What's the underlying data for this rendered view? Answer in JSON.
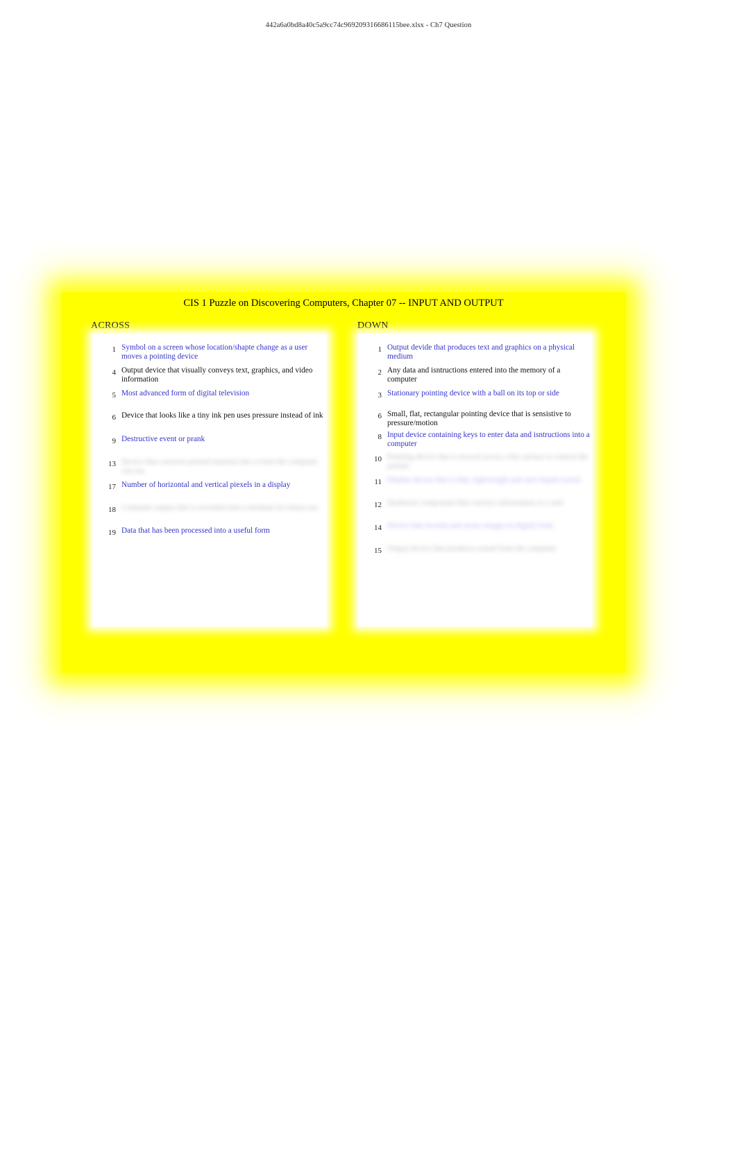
{
  "document": {
    "header_title": "442a6a0bd8a40c5a9cc74c969209316686115bee.xlsx - Ch7 Question",
    "puzzle_title": "CIS 1 Puzzle on Discovering Computers, Chapter 07 -- INPUT AND OUTPUT",
    "colors": {
      "page_background": "#FFFF00",
      "panel_background": "#FFFFFF",
      "clue_blue": "#3333CC",
      "clue_black": "#111111"
    }
  },
  "across": {
    "heading": "ACROSS",
    "clues": [
      {
        "number": "1",
        "text": "Symbol on a screen whose location/shapte change as a user moves a pointing device",
        "color": "blue",
        "redacted": false
      },
      {
        "number": "4",
        "text": "Output device that visually conveys text, graphics, and video information",
        "color": "black",
        "redacted": false
      },
      {
        "number": "5",
        "text": "Most advanced form of digital television",
        "color": "blue",
        "redacted": false
      },
      {
        "number": "6",
        "text": "Device that looks like a tiny ink pen uses pressure instead of ink",
        "color": "black",
        "redacted": false
      },
      {
        "number": "9",
        "text": "Destructive event or prank",
        "color": "blue",
        "redacted": false
      },
      {
        "number": "13",
        "text": "Device that converts printed material into a form the computer can use",
        "color": "black",
        "redacted": true
      },
      {
        "number": "17",
        "text": "Number of horizontal and vertical piexels in a display",
        "color": "blue",
        "redacted": false
      },
      {
        "number": "18",
        "text": "Computer output that is recorded onto a medium for future use",
        "color": "black",
        "redacted": true
      },
      {
        "number": "19",
        "text": "Data that has been processed into a useful form",
        "color": "blue",
        "redacted": false
      }
    ]
  },
  "down": {
    "heading": "DOWN",
    "clues": [
      {
        "number": "1",
        "text": "Output devide that produces text and graphics on a physical medium",
        "color": "blue",
        "redacted": false
      },
      {
        "number": "2",
        "text": "Any data and isntructions entered into the memory of a computer",
        "color": "black",
        "redacted": false
      },
      {
        "number": "3",
        "text": "Stationary pointing device with a ball on its top or side",
        "color": "blue",
        "redacted": false
      },
      {
        "number": "6",
        "text": "Small, flat, rectangular pointing device that is sensistive to pressure/motion",
        "color": "black",
        "redacted": false
      },
      {
        "number": "8",
        "text": "Input device containing keys to enter data and isntructions into a computer",
        "color": "blue",
        "redacted": false,
        "partial_redacted_line": true
      },
      {
        "number": "10",
        "text": "Pointing device that is moved across a flat surface to control the pointer",
        "color": "black",
        "redacted": true
      },
      {
        "number": "11",
        "text": "Display device that is thin, lightweight and uses liquid crystal",
        "color": "blue",
        "redacted": true
      },
      {
        "number": "12",
        "text": "Hardware component that conveys information to a user",
        "color": "black",
        "redacted": true
      },
      {
        "number": "14",
        "text": "Device that records and stores images in digital form",
        "color": "blue",
        "redacted": true
      },
      {
        "number": "15",
        "text": "Output device that produces sound from the computer",
        "color": "black",
        "redacted": true
      }
    ]
  }
}
